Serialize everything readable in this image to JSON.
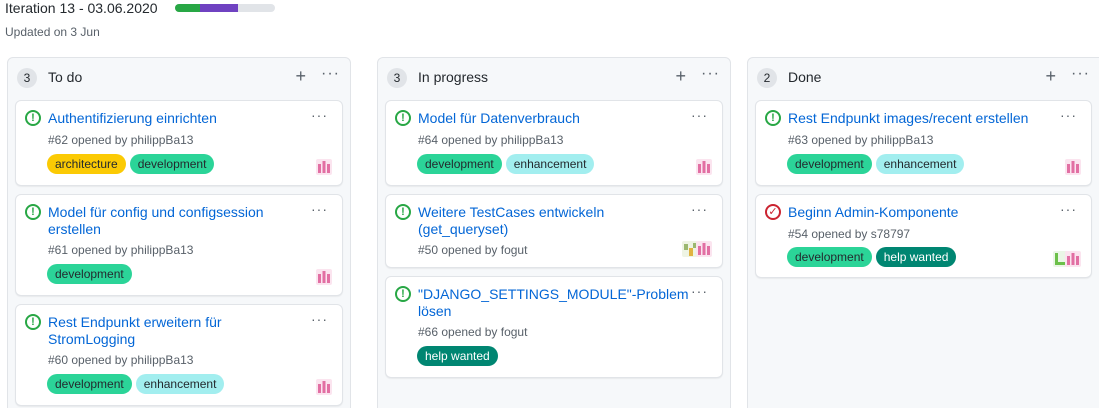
{
  "header": {
    "title": "Iteration 13 - 03.06.2020",
    "updated": "Updated on 3 Jun",
    "progress": {
      "done": 0.25,
      "in_progress": 0.375,
      "color_done": "#28a745",
      "color_in_progress": "#6f42c1",
      "color_todo": "#e1e4e8"
    }
  },
  "columns": [
    {
      "name": "To do",
      "count": "3",
      "cards": [
        {
          "title": "Authentifizierung einrichten",
          "meta": "#62 opened by philippBa13",
          "labels": [
            "architecture",
            "development"
          ],
          "state": "open"
        },
        {
          "title": "Model für config und configsession erstellen",
          "meta": "#61 opened by philippBa13",
          "labels": [
            "development"
          ],
          "state": "open"
        },
        {
          "title": "Rest Endpunkt erweitern für StromLogging",
          "meta": "#60 opened by philippBa13",
          "labels": [
            "development",
            "enhancement"
          ],
          "state": "open"
        }
      ]
    },
    {
      "name": "In progress",
      "count": "3",
      "cards": [
        {
          "title": "Model für Datenverbrauch",
          "meta": "#64 opened by philippBa13",
          "labels": [
            "development",
            "enhancement"
          ],
          "state": "open"
        },
        {
          "title": "Weitere TestCases entwickeln (get_queryset)",
          "meta": "#50 opened by fogut",
          "labels": [],
          "state": "open"
        },
        {
          "title": "\"DJANGO_SETTINGS_MODULE\"-Problem lösen",
          "meta": "#66 opened by fogut",
          "labels": [
            "help wanted"
          ],
          "state": "open"
        }
      ]
    },
    {
      "name": "Done",
      "count": "2",
      "cards": [
        {
          "title": "Rest Endpunkt images/recent erstellen",
          "meta": "#63 opened by philippBa13",
          "labels": [
            "development",
            "enhancement"
          ],
          "state": "open"
        },
        {
          "title": "Beginn Admin-Komponente",
          "meta": "#54 opened by s78797",
          "labels": [
            "development",
            "help wanted"
          ],
          "state": "closed"
        }
      ]
    }
  ],
  "label_colors": {
    "architecture": {
      "bg": "#fbca04",
      "fg": "#24292e"
    },
    "development": {
      "bg": "#2bd498",
      "fg": "#24292e"
    },
    "enhancement": {
      "bg": "#a2eeef",
      "fg": "#24292e"
    },
    "help wanted": {
      "bg": "#008672",
      "fg": "#ffffff"
    }
  },
  "icons": {
    "open_issue": "issue-opened-icon",
    "closed_issue": "issue-closed-icon",
    "add": "plus-icon",
    "menu": "kebab-horizontal-icon"
  }
}
